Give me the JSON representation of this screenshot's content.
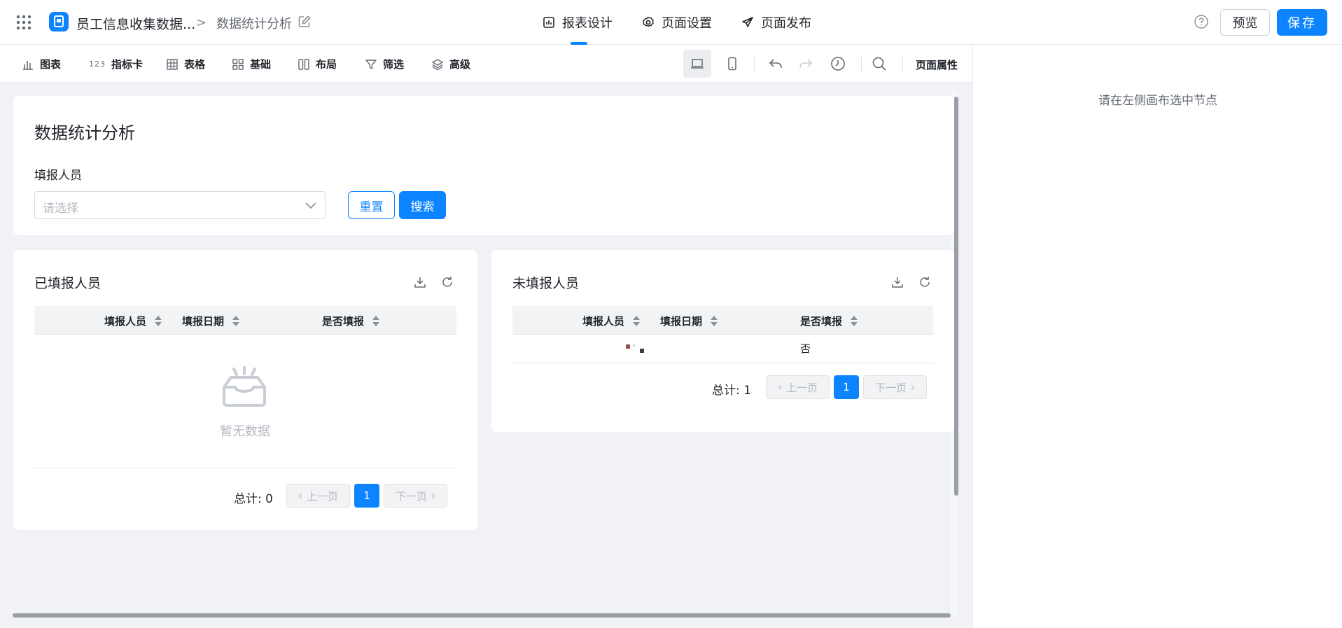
{
  "header": {
    "app_name": "员工信息收集数据...",
    "breadcrumb_sep": ">",
    "page_name": "数据统计分析",
    "tabs": [
      {
        "label": "报表设计",
        "icon": "report-icon",
        "active": true
      },
      {
        "label": "页面设置",
        "icon": "gear-icon",
        "active": false
      },
      {
        "label": "页面发布",
        "icon": "send-icon",
        "active": false
      }
    ],
    "preview_label": "预览",
    "save_label": "保存"
  },
  "toolbar": {
    "items": [
      {
        "label": "图表",
        "icon": "bar-chart-icon"
      },
      {
        "label": "指标卡",
        "icon": "number-icon",
        "icon_text": "123"
      },
      {
        "label": "表格",
        "icon": "table-icon"
      },
      {
        "label": "基础",
        "icon": "basic-icon"
      },
      {
        "label": "布局",
        "icon": "layout-icon"
      },
      {
        "label": "筛选",
        "icon": "filter-icon"
      },
      {
        "label": "高级",
        "icon": "layers-icon"
      }
    ],
    "page_props_label": "页面属性"
  },
  "right_panel": {
    "hint": "请在左侧画布选中节点"
  },
  "filter_card": {
    "title": "数据统计分析",
    "field_label": "填报人员",
    "select_placeholder": "请选择",
    "reset_label": "重置",
    "search_label": "搜索"
  },
  "filled_card": {
    "title": "已填报人员",
    "columns": [
      "填报人员",
      "填报日期",
      "是否填报"
    ],
    "empty_text": "暂无数据",
    "total_text": "总计: 0",
    "prev_label": "上一页",
    "current_page": "1",
    "next_label": "下一页"
  },
  "unfilled_card": {
    "title": "未填报人员",
    "columns": [
      "填报人员",
      "填报日期",
      "是否填报"
    ],
    "rows": [
      {
        "person": "",
        "date": "",
        "filled": "否"
      }
    ],
    "total_text": "总计: 1",
    "prev_label": "上一页",
    "current_page": "1",
    "next_label": "下一页"
  },
  "colors": {
    "accent": "#0d84ff",
    "canvas_bg": "#f0f2f5",
    "header_bg": "#ffffff"
  }
}
